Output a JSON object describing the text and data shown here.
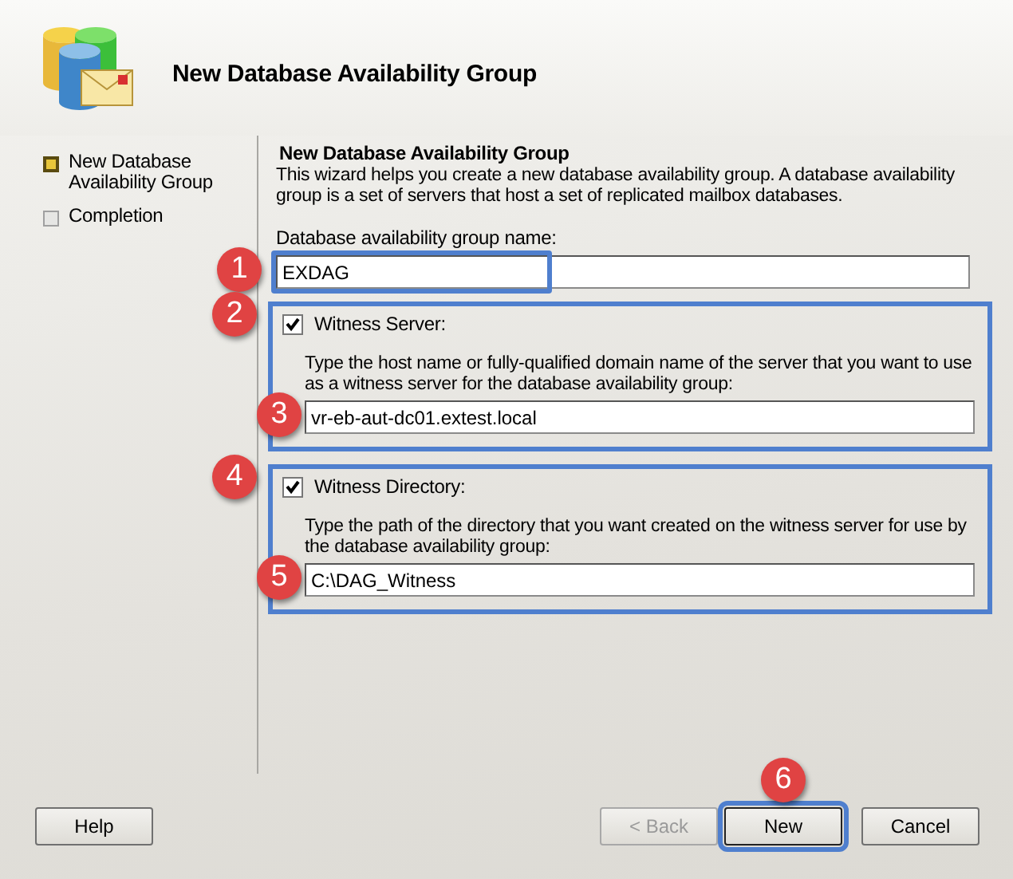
{
  "window": {
    "title": "New Database Availability Group"
  },
  "steps": [
    {
      "label": "New Database Availability Group",
      "selected": true
    },
    {
      "label": "Completion",
      "selected": false
    }
  ],
  "page": {
    "heading": "New Database Availability Group",
    "description": "This wizard helps you create a new database availability group. A database availability group is a set of servers that host a set of replicated mailbox databases.",
    "name_field": {
      "label": "Database availability group name:",
      "value": "EXDAG",
      "highlighted": true,
      "callout": "1"
    },
    "witness_server": {
      "label": "Witness Server:",
      "checked": true,
      "highlighted": true,
      "callout": "2",
      "description": "Type the host name or fully-qualified domain name of the server that you want to use as a witness server for the database availability group:",
      "field": {
        "value": "vr-eb-aut-dc01.extest.local",
        "callout": "3"
      }
    },
    "witness_directory": {
      "label": "Witness Directory:",
      "checked": true,
      "highlighted": true,
      "callout": "4",
      "description": "Type the path of the directory that you want created on the witness server for use by the database availability group:",
      "field": {
        "value": "C:\\DAG_Witness",
        "callout": "5"
      }
    }
  },
  "buttons": [
    {
      "label": "Help",
      "disabled": false,
      "highlighted": false
    },
    {
      "label": "< Back",
      "disabled": true,
      "highlighted": false
    },
    {
      "label": "New",
      "disabled": false,
      "highlighted": true,
      "callout": "6"
    },
    {
      "label": "Cancel",
      "disabled": false,
      "highlighted": false
    }
  ]
}
